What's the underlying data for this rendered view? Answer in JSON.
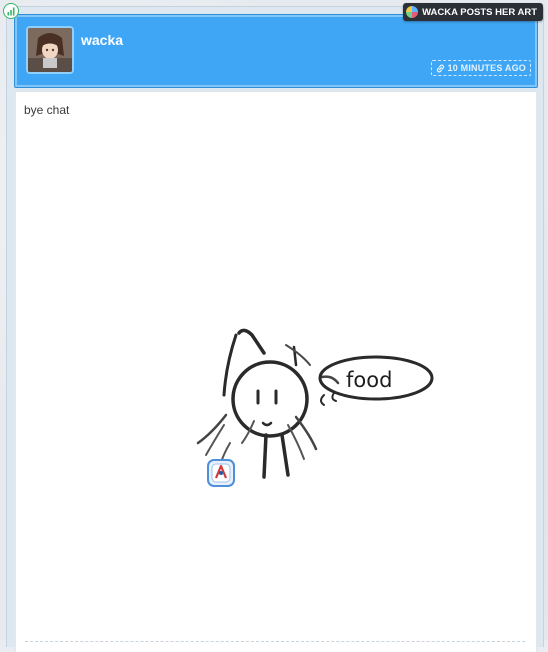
{
  "post": {
    "author": "wacka",
    "blog_tag": "WACKA POSTS HER ART",
    "timestamp": "10 MINUTES AGO",
    "caption": "bye chat",
    "drawing_text": "food"
  },
  "icons": {
    "status": "signal-bars-icon",
    "timestamp": "link-icon",
    "blog": "blog-avatar-icon"
  },
  "colors": {
    "header": "#3fa6f5",
    "tag_bg": "#2b2f36",
    "status": "#34b36a"
  }
}
